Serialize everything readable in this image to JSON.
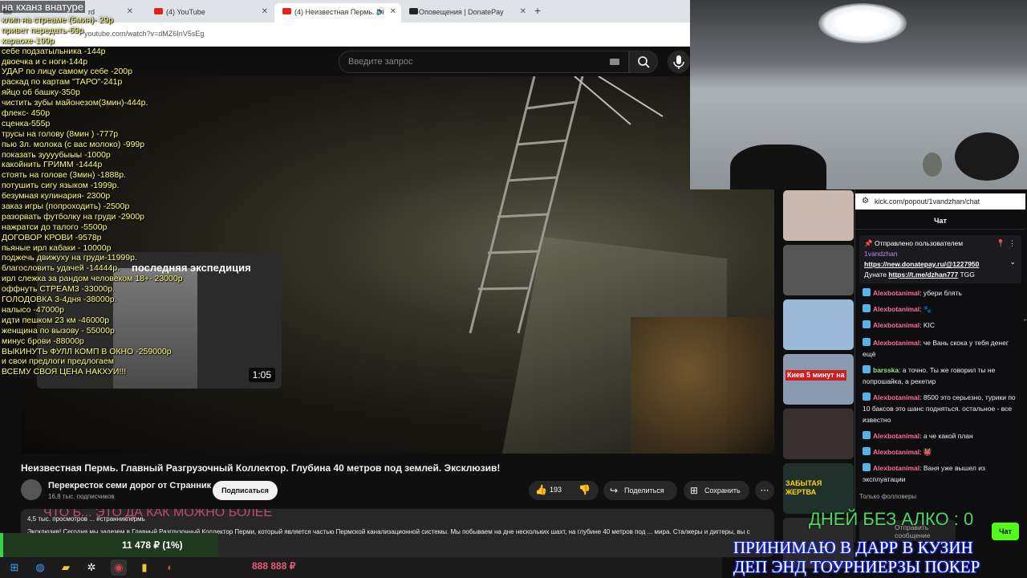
{
  "browser": {
    "tabs": [
      {
        "label": "rd",
        "icon": "dashboard-icon"
      },
      {
        "label": "(4) YouTube",
        "icon": "youtube-icon"
      },
      {
        "label": "(4) Неизвестная Пермь. Гл",
        "icon": "youtube-icon"
      },
      {
        "label": "Оповещения | DonatePay",
        "icon": "donatepay-icon"
      }
    ],
    "url": "youtube.com/watch?v=dMZ6InV5sEg"
  },
  "youtube": {
    "search_placeholder": "Введите запрос",
    "video_title": "Неизвестная Пермь. Главный Разгрузочный Коллектор. Глубина 40 метров под землей. Эксклюзив!",
    "channel_name": "Перекресток семи дорог от Странник",
    "subscribers": "16,8 тыс. подписчиков",
    "subscribe_label": "Подписаться",
    "likes": "193",
    "share_label": "Поделиться",
    "save_label": "Сохранить",
    "description_meta": "4,5 тыс. просмотров   ...   #странникпермь",
    "description_text": "Эксклюзив! Сегодня мы залезем в Главный Разгрузочный Коллектор Перми, который является частью Пермской канализационной системы. Мы побываем на дне нескольких шахт, на глубине 40 метров под ... мира. Сталкеры и диггеры, вы с нами?!",
    "pip_title": "последняя экспедиция",
    "pip_duration": "1:05",
    "ticker": "ЧТО Б... ЭТО ДА КАК МОЖНО БОЛЕЕ"
  },
  "overlay": {
    "title": "на кханз внатуре",
    "prices": [
      "клип на стреаме (5мин)- 29р",
      "привет передать-69р",
      "караоке-199р",
      "себе подзатыльника -144р",
      "двоечка и с ноги-144р",
      "УДАР по лицу самому себе -200р",
      "раскад по картам \"ТАРО\"-241р",
      "яйцо об башку-350р",
      "чистить зубы майонезом(3мин)-444р.",
      "флекс- 450р",
      "сценка-555р",
      "трусы на голову (8мин ) -777р",
      "пью 3л. молока (с вас молоко) -999р",
      "показать зуууубыыы -1000р",
      "какойнить ГРИММ -1444р",
      "стоять на голове (3мин) -1888р.",
      "потушить сигу языком -1999р.",
      "безумная кулинария- 2300р",
      "заказ игры (попроходить) -2500р",
      "разорвать футболку на груди -2900р",
      "нажратси до талого -5500р",
      "ДОГОВОР КРОВИ -9578р",
      "пьяные ирл кабаки - 10000р",
      "поджечь движуху на груди-11999р.",
      "благословить удачей -14444р.",
      "ирл слежка за рандом человеком 18+- 23000р",
      "оффнуть СТРЕАМ3 -33000р.",
      "ГОЛОДОВКА 3-4дня -38000р.",
      "налысо -47000р",
      "идти пешком 23 км -46000р",
      "женщина по вызову - 55000р",
      "минус брови -88000р",
      "ВЫКИНУТЬ ФУЛЛ КОМП В ОКНО -259000р",
      "и свои предлоги предлогаем",
      "ВСЕМУ СВОЯ ЦЕНА НАКХУИ!!!"
    ]
  },
  "donation": {
    "collected": "11 478 ₽ (1%)",
    "goal_amount": "888 888 ₽"
  },
  "sidebar_thumbs": [
    {
      "text": "",
      "bg": "#c9b8b0"
    },
    {
      "text": "",
      "bg": "#555"
    },
    {
      "text": "",
      "bg": "#9ab8d8"
    },
    {
      "text": "Киев 5 минут на",
      "bg": "#8a9ab0"
    },
    {
      "text": "",
      "bg": "#3a3030"
    },
    {
      "text": "ЗАБЫТАЯ ЖЕРТВА",
      "bg": "#20302a"
    },
    {
      "text": "",
      "bg": "#2a2a2a"
    }
  ],
  "chat": {
    "popout_url": "kick.com/popout/1vandzhan/chat",
    "header": "Чат",
    "pinned": {
      "label": "Отправлено пользователем",
      "user": "1vandzhan",
      "link1": "https://new.donatepay.ru/@1227950",
      "line2_prefix": "Дунате",
      "link2": "https://t.me/dzhan777",
      "line2_suffix": "TGG"
    },
    "messages": [
      {
        "user": "Alexbotanimal",
        "text": "убери блять",
        "color": "#ff6b9a"
      },
      {
        "user": "Alexbotanimal",
        "text": "🐾",
        "color": "#ff6b9a"
      },
      {
        "user": "Alexbotanimal",
        "text": "KIC",
        "color": "#ff6b9a"
      },
      {
        "user": "Alexbotanimal",
        "text": "че Вань скока у тебя денег ещё",
        "color": "#ff6b9a"
      },
      {
        "user": "barsska",
        "text": "а точно. Ты же говорил ты не попрошайка, а рекетир",
        "color": "#9be37a"
      },
      {
        "user": "Alexbotanimal",
        "text": "8500 это серьезно, турики по 10 баксов это шанс подняться. остальное - все известно",
        "color": "#ff6b9a"
      },
      {
        "user": "Alexbotanimal",
        "text": "а че какой план",
        "color": "#ff6b9a"
      },
      {
        "user": "Alexbotanimal",
        "text": "👹",
        "color": "#ff6b9a"
      },
      {
        "user": "Alexbotanimal",
        "text": "Ваня уже вышел из эксплуатации",
        "color": "#ff6b9a"
      }
    ],
    "followers_only": "Только фолловеры",
    "input_placeholder": "Отправить сообщение",
    "send_label": "Чат"
  },
  "stream": {
    "days_counter": "ДНЕЙ БЕЗ АЛКО : 0",
    "promo_line1": "ПРИНИМАЮ В ДАРР В КУЗИН",
    "promo_line2": "ДЕП ЭНД ТОУРНИЕРЗЫ ПОКЕР"
  }
}
